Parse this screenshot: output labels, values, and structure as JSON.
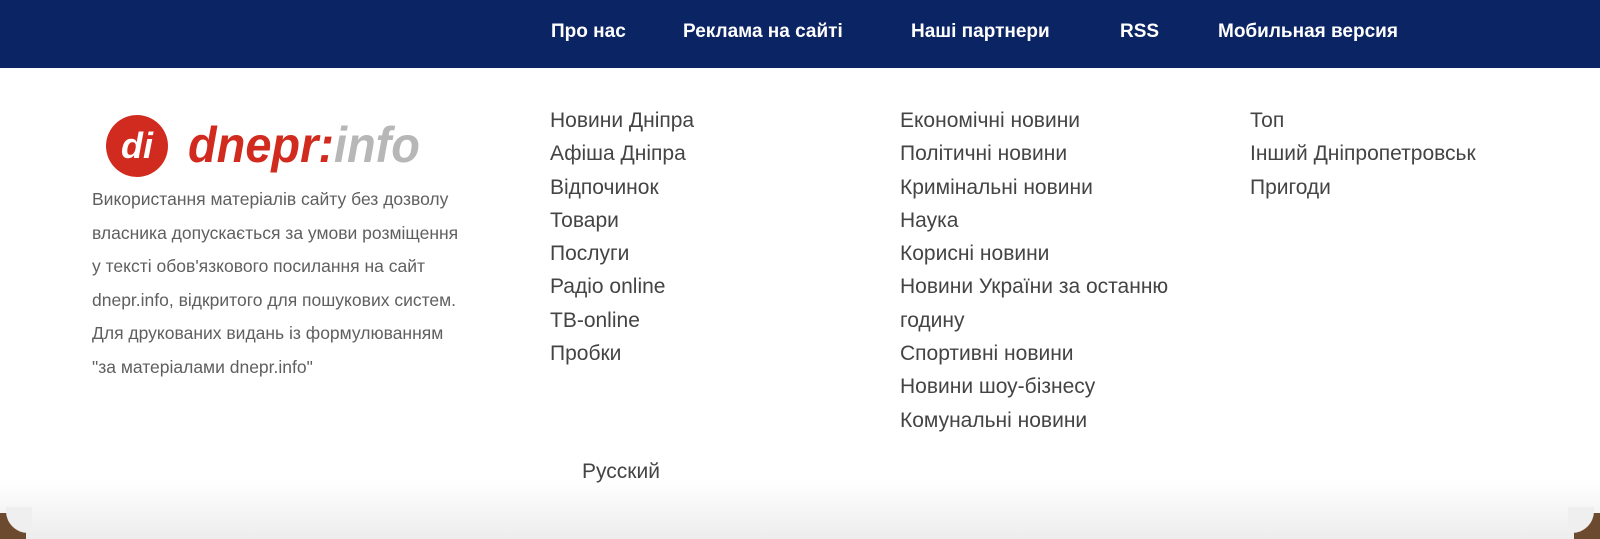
{
  "top_nav": {
    "items": [
      "Про нас",
      "Реклама на сайті",
      "Наші партнери",
      "RSS",
      "Мобильная версия"
    ]
  },
  "logo": {
    "glyph": "di",
    "text_left": "dnepr",
    "text_right": "info"
  },
  "about_lines": [
    "Використання матеріалів сайту без дозволу",
    "власника допускається за умови розміщення",
    "у тексті обов'язкового посилання на сайт",
    "dnepr.info, відкритого для пошукових систем.",
    "Для друкованих видань із формулюванням",
    "\"за матеріалами dnepr.info\""
  ],
  "columns": {
    "col1": [
      "Новини Дніпра",
      "Афіша Дніпра",
      "Відпочинок",
      "Товари",
      "Послуги",
      "Радіо online",
      "ТВ-online",
      "Пробки"
    ],
    "col2": [
      "Економічні новини",
      "Політичні новини",
      "Кримінальні новини",
      "Наука",
      "Корисні новини",
      "Новини України за останню",
      "годину",
      "Спортивні новини",
      "Новини шоу-бізнесу",
      "Комунальні новини"
    ],
    "col3": [
      "Топ",
      "Інший Дніпропетровськ",
      "Пригоди"
    ]
  },
  "language_link": "Русский",
  "colors": {
    "topbar_bg": "#0b2463",
    "logo_red": "#d12b1f",
    "logo_gray": "#b7b7b7"
  }
}
